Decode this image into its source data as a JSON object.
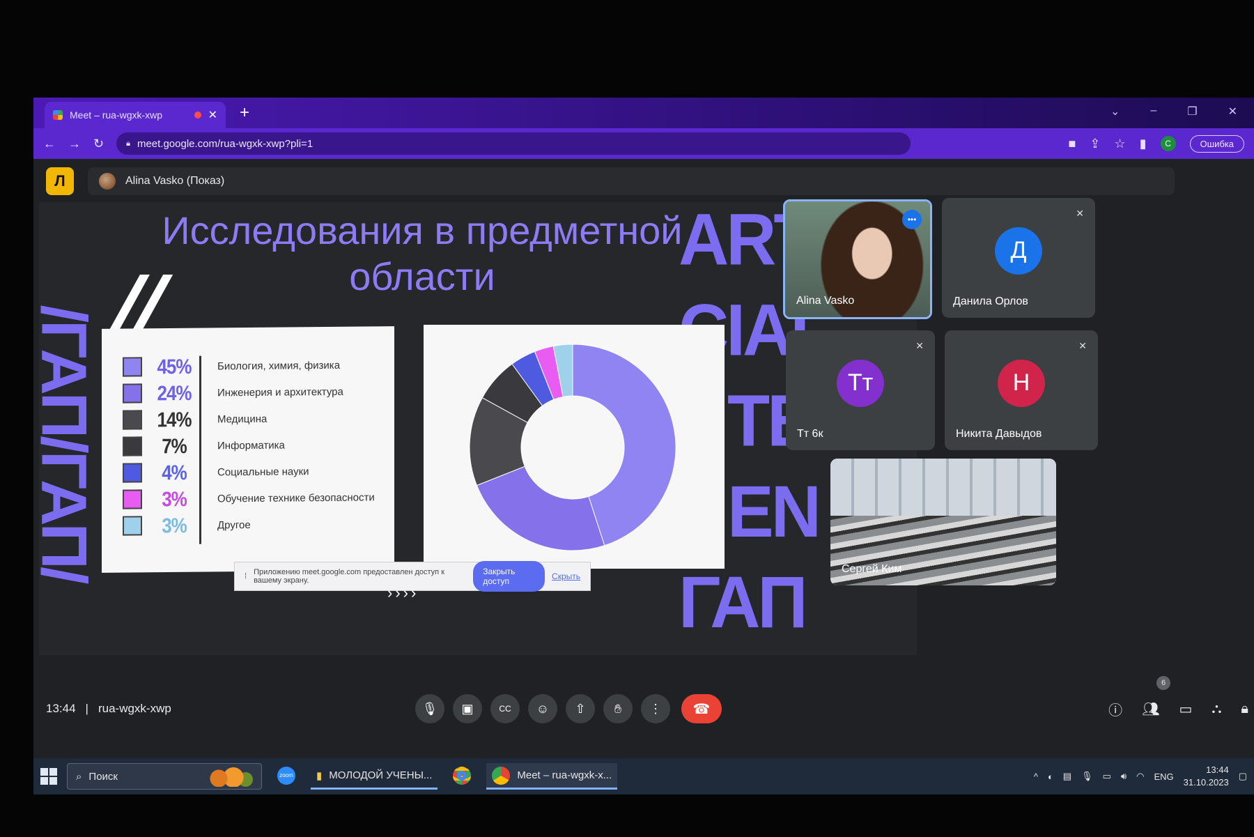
{
  "browser": {
    "tab_title": "Meet – rua-wgxk-xwp",
    "tab_close": "✕",
    "new_tab": "+",
    "url": "meet.google.com/rua-wgxk-xwp?pli=1",
    "profile_initial": "C",
    "error_button": "Ошибка"
  },
  "meet": {
    "app_logo": "Л",
    "presenter": "Alina Vasko (Показ)",
    "meeting_time": "13:44",
    "meeting_code": "rua-wgxk-xwp",
    "participants_count": "6"
  },
  "slide": {
    "title": "Исследования в предметной области",
    "quote_marks": "//",
    "side_text": "/ΓΑΠ/ΓΑΠ/",
    "art_lines": [
      "ARTI",
      "CIAL",
      "TE",
      "EN",
      "ΓΑΠ"
    ],
    "chevrons": "››››"
  },
  "chart_data": {
    "type": "pie",
    "categories": [
      "Биология, химия, физика",
      "Инженерия и архитектура",
      "Медицина",
      "Информатика",
      "Социальные науки",
      "Обучение технике безопасности",
      "Другое"
    ],
    "values": [
      45,
      24,
      14,
      7,
      4,
      3,
      3
    ],
    "value_labels": [
      "45%",
      "24%",
      "14%",
      "7%",
      "4%",
      "3%",
      "3%"
    ],
    "colors": [
      "#8f84f2",
      "#8571ea",
      "#4a4a4e",
      "#3a3a3e",
      "#4e5be0",
      "#e85cf2",
      "#9fd2ea"
    ],
    "label_colors": [
      "#6f62e8",
      "#6f62e8",
      "#333333",
      "#333333",
      "#5a63e8",
      "#c64be0",
      "#7bbde0"
    ],
    "donut": true
  },
  "share_notice": {
    "text": "Приложению meet.google.com предоставлен доступ к вашему экрану.",
    "stop_button": "Закрыть доступ",
    "hide_link": "Скрыть"
  },
  "participants": [
    {
      "name": "Alina Vasko",
      "initial": "",
      "color": ""
    },
    {
      "name": "Данила Орлов",
      "initial": "Д",
      "color": "#1a73e8"
    },
    {
      "name": "Тт 6к",
      "initial": "Тт",
      "color": "#8430ce"
    },
    {
      "name": "Никита Давыдов",
      "initial": "Н",
      "color": "#d0244a"
    },
    {
      "name": "Сергей Ким",
      "initial": "",
      "color": ""
    }
  ],
  "taskbar": {
    "search_placeholder": "Поиск",
    "app_zoom": "zoom",
    "app_folder": "МОЛОДОЙ УЧЕНЫ...",
    "app_meet": "Meet – rua-wgxk-x...",
    "lang": "ENG",
    "time": "13:44",
    "date": "31.10.2023"
  }
}
